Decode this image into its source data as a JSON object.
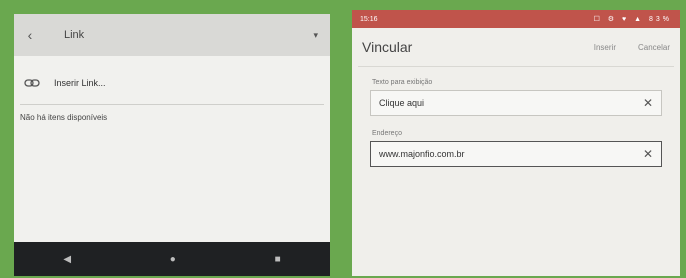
{
  "left": {
    "title": "Link",
    "back_glyph": "‹",
    "caret_glyph": "▾",
    "insert_label": "Inserir Link...",
    "empty_message": "Não há itens disponíveis",
    "nav": {
      "back": "◀",
      "home": "●",
      "recent": "■"
    }
  },
  "right": {
    "status": {
      "time": "15:16",
      "icons": "☐ ⚙ ♥ ▲ 83%"
    },
    "title": "Vincular",
    "insert_button": "Inserir",
    "cancel_button": "Cancelar",
    "display_text": {
      "label": "Texto para exibição",
      "value": "Clique aqui"
    },
    "address": {
      "label": "Endereço",
      "value": "www.majonfio.com.br"
    },
    "clear_glyph": "✕"
  },
  "colors": {
    "status_bar": "#c0544b",
    "nav_bar": "#1f2123",
    "background": "#6aa84f"
  }
}
